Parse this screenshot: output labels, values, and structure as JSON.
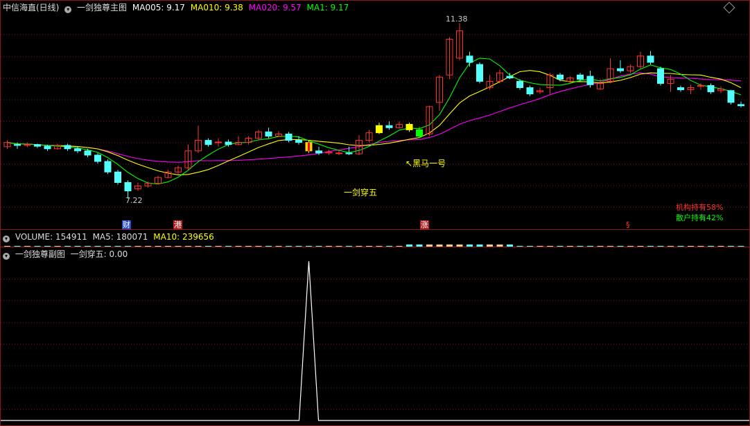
{
  "main": {
    "stock_title": "中信海直(日线)",
    "indicator_name": "一剑独尊主图",
    "ma_items": [
      {
        "label": "MA005: 9.17",
        "color": "#ffffff"
      },
      {
        "label": "MA010: 9.38",
        "color": "#ffff00"
      },
      {
        "label": "MA020: 9.57",
        "color": "#ff00ff"
      },
      {
        "label": "MA1: 9.17",
        "color": "#00ff00"
      }
    ],
    "high_label": "11.38",
    "low_label": "7.22",
    "signal_heima": "黑马一号",
    "signal_yijian": "一剑穿五",
    "holding_inst": "机构持有58%",
    "holding_retail": "散户持有42%",
    "event_tags": [
      "财",
      "港",
      "涨",
      "§"
    ]
  },
  "volume": {
    "label": "VOLUME: 154911",
    "ma5": "MA5: 180071",
    "ma10": "MA10: 239656"
  },
  "sub": {
    "indicator_name": "一剑独尊副图",
    "value_label": "一剑穿五: 0.00"
  },
  "colors": {
    "up": "#ff3232",
    "down": "#54ffff",
    "ma5": "#ffffff",
    "ma10": "#ffff00",
    "ma20": "#ff00ff",
    "ma1": "#00ff00",
    "grid": "#8b1a1a"
  },
  "chart_data": {
    "type": "candlestick",
    "candles": [
      [
        8.45,
        8.55,
        8.4,
        8.6
      ],
      [
        8.5,
        8.48,
        8.4,
        8.55
      ],
      [
        8.48,
        8.5,
        8.44,
        8.55
      ],
      [
        8.5,
        8.46,
        8.42,
        8.52
      ],
      [
        8.46,
        8.4,
        8.35,
        8.5
      ],
      [
        8.4,
        8.48,
        8.38,
        8.52
      ],
      [
        8.48,
        8.4,
        8.35,
        8.52
      ],
      [
        8.4,
        8.35,
        8.3,
        8.45
      ],
      [
        8.35,
        8.25,
        8.2,
        8.4
      ],
      [
        8.25,
        8.1,
        8.05,
        8.3
      ],
      [
        8.1,
        7.85,
        7.8,
        8.15
      ],
      [
        7.85,
        7.6,
        7.55,
        7.9
      ],
      [
        7.6,
        7.4,
        7.22,
        7.65
      ],
      [
        7.45,
        7.52,
        7.4,
        7.6
      ],
      [
        7.52,
        7.58,
        7.48,
        7.62
      ],
      [
        7.58,
        7.72,
        7.55,
        7.76
      ],
      [
        7.72,
        7.85,
        7.7,
        7.9
      ],
      [
        7.85,
        7.95,
        7.8,
        8.0
      ],
      [
        7.95,
        8.35,
        7.9,
        8.5
      ],
      [
        8.35,
        8.6,
        8.3,
        8.95
      ],
      [
        8.6,
        8.5,
        8.45,
        8.65
      ],
      [
        8.55,
        8.56,
        8.45,
        8.65
      ],
      [
        8.56,
        8.5,
        8.45,
        8.62
      ],
      [
        8.5,
        8.55,
        8.48,
        8.7
      ],
      [
        8.55,
        8.65,
        8.5,
        8.7
      ],
      [
        8.65,
        8.8,
        8.6,
        8.85
      ],
      [
        8.8,
        8.7,
        8.65,
        8.9
      ],
      [
        8.7,
        8.75,
        8.68,
        8.82
      ],
      [
        8.75,
        8.6,
        8.55,
        8.8
      ],
      [
        8.6,
        8.55,
        8.5,
        8.7
      ],
      [
        8.55,
        8.35,
        8.3,
        8.6
      ],
      [
        8.35,
        8.3,
        8.25,
        8.45
      ],
      [
        8.3,
        8.32,
        8.25,
        8.38
      ],
      [
        8.3,
        8.3,
        8.25,
        8.36
      ],
      [
        8.3,
        8.28,
        8.25,
        8.45
      ],
      [
        8.28,
        8.6,
        8.25,
        8.72
      ],
      [
        8.6,
        8.78,
        8.55,
        8.85
      ],
      [
        8.78,
        8.95,
        8.75,
        9.02
      ],
      [
        8.95,
        8.9,
        8.85,
        9.05
      ],
      [
        8.9,
        8.98,
        8.88,
        9.05
      ],
      [
        8.98,
        8.85,
        8.8,
        9.02
      ],
      [
        8.85,
        8.7,
        8.65,
        8.92
      ],
      [
        8.75,
        9.4,
        8.7,
        9.42
      ],
      [
        9.5,
        10.1,
        9.3,
        10.15
      ],
      [
        10.15,
        11.0,
        10.05,
        11.05
      ],
      [
        10.55,
        11.2,
        10.5,
        11.38
      ],
      [
        10.6,
        10.45,
        10.35,
        10.7
      ],
      [
        10.4,
        10.0,
        9.95,
        10.45
      ],
      [
        9.85,
        10.0,
        9.8,
        10.15
      ],
      [
        10.0,
        10.2,
        9.95,
        10.28
      ],
      [
        10.12,
        10.08,
        10.05,
        10.2
      ],
      [
        10.0,
        9.85,
        9.8,
        10.05
      ],
      [
        9.85,
        9.7,
        9.65,
        9.9
      ],
      [
        9.75,
        9.78,
        9.7,
        9.85
      ],
      [
        9.85,
        10.15,
        9.7,
        10.2
      ],
      [
        10.15,
        10.05,
        10.0,
        10.2
      ],
      [
        10.0,
        10.08,
        9.95,
        10.12
      ],
      [
        10.15,
        10.05,
        10.0,
        10.2
      ],
      [
        10.12,
        9.92,
        9.85,
        10.25
      ],
      [
        9.82,
        9.95,
        9.8,
        10.05
      ],
      [
        10.0,
        10.3,
        9.95,
        10.55
      ],
      [
        10.3,
        10.25,
        10.2,
        10.5
      ],
      [
        10.25,
        10.35,
        10.2,
        10.4
      ],
      [
        10.35,
        10.6,
        10.3,
        10.7
      ],
      [
        10.6,
        10.45,
        10.4,
        10.72
      ],
      [
        10.3,
        9.95,
        9.9,
        10.35
      ],
      [
        9.95,
        10.05,
        9.75,
        10.15
      ],
      [
        9.85,
        9.8,
        9.75,
        9.9
      ],
      [
        9.8,
        9.85,
        9.7,
        9.92
      ],
      [
        9.88,
        9.9,
        9.8,
        9.95
      ],
      [
        9.9,
        9.75,
        9.7,
        9.95
      ],
      [
        9.78,
        9.82,
        9.72,
        9.88
      ],
      [
        9.78,
        9.5,
        9.45,
        9.8
      ],
      [
        9.45,
        9.42,
        9.38,
        9.52
      ]
    ],
    "fields": [
      "open",
      "close",
      "low",
      "high"
    ],
    "special_bars": [
      {
        "index": 30,
        "style": "yijian",
        "fill": "#ffd700",
        "core": "#ff0000"
      },
      {
        "index": 37,
        "style": "yellow",
        "fill": "#ffff00"
      },
      {
        "index": 40,
        "style": "yellow",
        "fill": "#ffff00"
      },
      {
        "index": 41,
        "style": "green",
        "fill": "#00ff00"
      }
    ],
    "sub_signal": {
      "index": 30,
      "value": 1
    },
    "ylim": [
      7.0,
      11.6
    ]
  }
}
